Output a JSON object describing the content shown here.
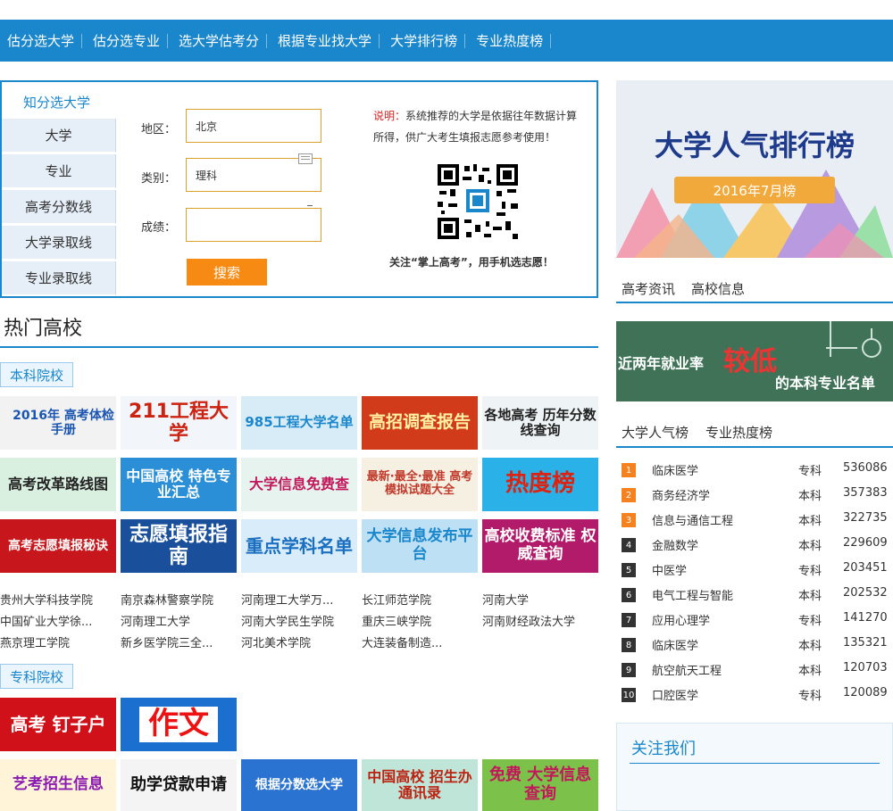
{
  "nav": {
    "items": [
      "估分选大学",
      "估分选专业",
      "选大学估考分",
      "根据专业找大学",
      "大学排行榜",
      "专业热度榜"
    ]
  },
  "search_panel": {
    "title": "知分选大学",
    "tabs": [
      "大学",
      "专业",
      "高考分数线",
      "大学录取线",
      "专业录取线"
    ],
    "region_label": "地区：",
    "region_value": "北京",
    "category_label": "类别：",
    "category_value": "理科",
    "score_label": "成绩：",
    "score_value": "",
    "search_button": "搜索",
    "note_prefix": "说明：",
    "note_text": "系统推荐的大学是依据往年数据计算所得，供广大考生填报志愿参考使用！",
    "qr_caption": "关注“掌上高考”，用手机选志愿！"
  },
  "hot": {
    "title": "热门高校",
    "undergrad_tag": "本科院校",
    "junior_tag": "专科院校",
    "banners_row1": [
      "2016年 高考体检手册",
      "211工程大学",
      "985工程大学名单",
      "高招调查报告",
      "各地高考 历年分数线查询"
    ],
    "banners_row2": [
      "高考改革路线图",
      "中国高校 特色专业汇总",
      "大学信息免费查",
      "最新·最全·最准 高考模拟试题大全",
      "热度榜"
    ],
    "banners_row3": [
      "高考志愿填报秘诀",
      "志愿填报指南",
      "重点学科名单",
      "大学信息发布平台",
      "高校收费标准 权威查询"
    ],
    "schools": [
      [
        "贵州大学科技学院",
        "南京森林警察学院",
        "河南理工大学万...",
        "长江师范学院",
        "河南大学"
      ],
      [
        "中国矿业大学徐...",
        "河南理工大学",
        "河南大学民生学院",
        "重庆三峡学院",
        "河南财经政法大学"
      ],
      [
        "燕京理工学院",
        "新乡医学院三全...",
        "河北美术学院",
        "大连装备制造..."
      ]
    ],
    "junior_banners_row1": [
      "高考 钉子户",
      "作文"
    ],
    "junior_banners_row2": [
      "艺考招生信息",
      "助学贷款申请",
      "根据分数选大学",
      "中国高校 招生办通讯录",
      "免费 大学信息查询"
    ]
  },
  "right": {
    "promo_title": "大学人气排行榜",
    "promo_subtitle": "2016年7月榜",
    "tabs1": [
      "高考资讯",
      "高校信息"
    ],
    "promo2_text1": "近两年就业率",
    "promo2_text2": "较低",
    "promo2_text3": "的本科专业名单",
    "tabs2": [
      "大学人气榜",
      "专业热度榜"
    ],
    "ranking": [
      {
        "rank": "1",
        "name": "临床医学",
        "type": "专科",
        "count": "536086"
      },
      {
        "rank": "2",
        "name": "商务经济学",
        "type": "本科",
        "count": "357383"
      },
      {
        "rank": "3",
        "name": "信息与通信工程",
        "type": "本科",
        "count": "322735"
      },
      {
        "rank": "4",
        "name": "金融数学",
        "type": "本科",
        "count": "229609"
      },
      {
        "rank": "5",
        "name": "中医学",
        "type": "专科",
        "count": "203451"
      },
      {
        "rank": "6",
        "name": "电气工程与智能",
        "type": "本科",
        "count": "202532"
      },
      {
        "rank": "7",
        "name": "应用心理学",
        "type": "专科",
        "count": "141270"
      },
      {
        "rank": "8",
        "name": "临床医学",
        "type": "本科",
        "count": "135321"
      },
      {
        "rank": "9",
        "name": "航空航天工程",
        "type": "本科",
        "count": "120703"
      },
      {
        "rank": "10",
        "name": "口腔医学",
        "type": "专科",
        "count": "120089"
      }
    ],
    "follow_title": "关注我们"
  },
  "colors": {
    "brand_blue": "#1a87cc",
    "accent_orange": "#f78a13",
    "rank_top": "#f5811f"
  }
}
